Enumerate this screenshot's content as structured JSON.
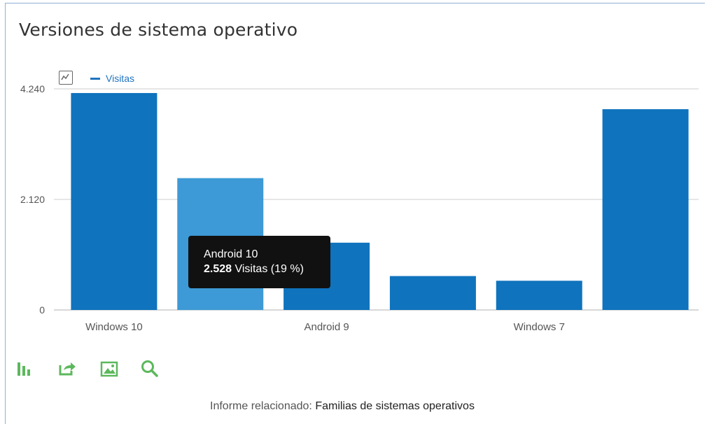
{
  "header": {
    "title": "Versiones de sistema operativo"
  },
  "legend": {
    "series_label": "Visitas",
    "series_color": "#1f74c0",
    "icon": "chart-toggle-icon"
  },
  "tooltip": {
    "category": "Android 10",
    "value": "2.528",
    "unit_and_share": " Visitas (19 %)"
  },
  "toolbar": {
    "icons": [
      "bar-chart-icon",
      "export-icon",
      "image-icon",
      "search-icon"
    ],
    "color": "#5cb85c"
  },
  "footer": {
    "related_prefix": "Informe relacionado: ",
    "related_link": "Familias de sistemas operativos"
  },
  "colors": {
    "bar": "#0f73bd",
    "bar_highlight": "#3d9ad6",
    "grid": "#dddddd"
  },
  "chart_data": {
    "type": "bar",
    "title": "Versiones de sistema operativo",
    "categories": [
      "Windows 10",
      "Android 10",
      "Android 9",
      "",
      "Windows 7",
      ""
    ],
    "shown_x_labels": [
      "Windows 10",
      "Android 9",
      "Windows 7"
    ],
    "series": [
      {
        "name": "Visitas",
        "values": [
          4160,
          2528,
          1290,
          650,
          560,
          3850
        ]
      }
    ],
    "highlighted_index": 1,
    "yticks": [
      "0",
      "2.120",
      "4.240"
    ],
    "ylim": [
      0,
      4240
    ],
    "grid": true,
    "legend": "top-left"
  }
}
